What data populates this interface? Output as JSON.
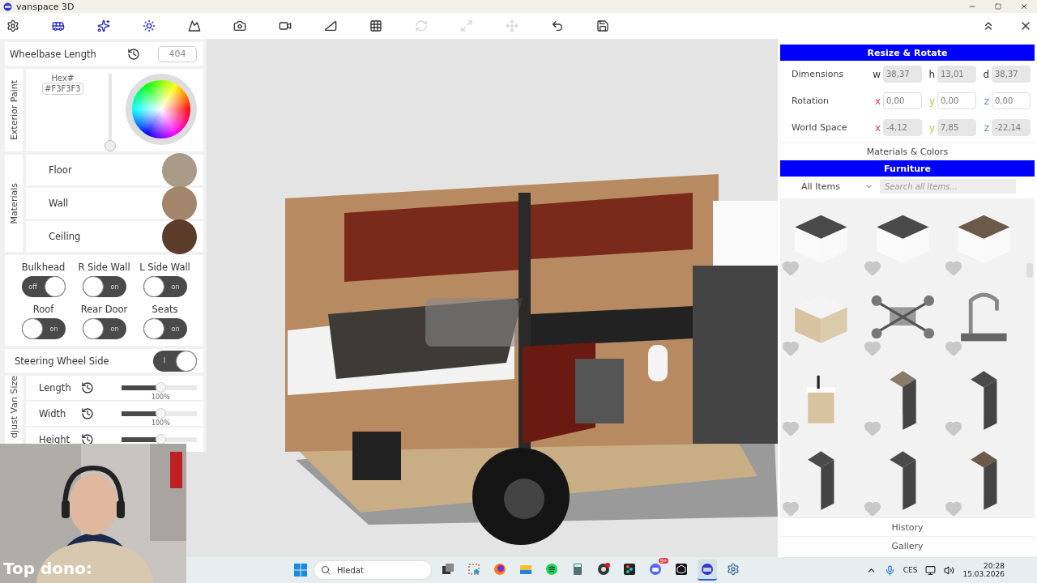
{
  "app": {
    "title": "vanspace 3D"
  },
  "toolbar": {
    "tools": [
      {
        "kind": "settings",
        "active": false,
        "disabled": false
      },
      {
        "kind": "van",
        "active": true,
        "disabled": false
      },
      {
        "kind": "sparkles",
        "active": true,
        "disabled": false
      },
      {
        "kind": "sun",
        "active": true,
        "disabled": false
      },
      {
        "kind": "terrain",
        "active": false,
        "disabled": false
      },
      {
        "kind": "camera",
        "active": false,
        "disabled": false
      },
      {
        "kind": "video",
        "active": false,
        "disabled": false
      },
      {
        "kind": "ruler",
        "active": false,
        "disabled": false
      },
      {
        "kind": "grid",
        "active": false,
        "disabled": false
      },
      {
        "kind": "rotate",
        "active": false,
        "disabled": true
      },
      {
        "kind": "resize",
        "active": false,
        "disabled": true
      },
      {
        "kind": "move",
        "active": false,
        "disabled": true
      },
      {
        "kind": "undo",
        "active": false,
        "disabled": false
      },
      {
        "kind": "save",
        "active": false,
        "disabled": false
      }
    ]
  },
  "left_panel": {
    "wheelbase": {
      "label": "Wheelbase Length",
      "value": "404"
    },
    "exterior_paint": {
      "title": "Exterior Paint",
      "hex_label": "Hex#",
      "hex_value": "#F3F3F3",
      "brightness": {
        "level": 0
      }
    },
    "materials": {
      "title": "Materials",
      "items": [
        {
          "label": "Floor",
          "color": "#a99b88"
        },
        {
          "label": "Wall",
          "color": "#a2856b"
        },
        {
          "label": "Ceiling",
          "color": "#5b3b29"
        }
      ]
    },
    "toggles": [
      {
        "label": "Bulkhead",
        "text": "off",
        "on": true
      },
      {
        "label": "R Side Wall",
        "text": "on",
        "on": false
      },
      {
        "label": "L Side Wall",
        "text": "on",
        "on": false
      },
      {
        "label": "Roof",
        "text": "on",
        "on": false
      },
      {
        "label": "Rear Door",
        "text": "on",
        "on": false
      },
      {
        "label": "Seats",
        "text": "on",
        "on": false
      }
    ],
    "steering": {
      "label": "Steering Wheel Side",
      "text": "I",
      "on": true
    },
    "van_size": {
      "title": "djust Van Size",
      "sliders": [
        {
          "label": "Length",
          "level": 0.52,
          "reading": "100%"
        },
        {
          "label": "Width",
          "level": 0.52,
          "reading": "100%"
        },
        {
          "label": "Height",
          "level": 0.52
        }
      ]
    }
  },
  "right_panel": {
    "resize": {
      "title": "Resize & Rotate",
      "rows": [
        {
          "label": "Dimensions",
          "fields": [
            {
              "axis": "w",
              "color": "#333333",
              "value": "38,37",
              "readonly": true
            },
            {
              "axis": "h",
              "color": "#333333",
              "value": "13,01",
              "readonly": true
            },
            {
              "axis": "d",
              "color": "#333333",
              "value": "38,37",
              "readonly": true
            }
          ]
        },
        {
          "label": "Rotation",
          "fields": [
            {
              "axis": "x",
              "color": "#d0405a",
              "value": "0,00",
              "readonly": false
            },
            {
              "axis": "y",
              "color": "#a8d040",
              "value": "0,00",
              "readonly": false
            },
            {
              "axis": "z",
              "color": "#5a8ad8",
              "value": "0,00",
              "readonly": false
            }
          ]
        },
        {
          "label": "World Space",
          "fields": [
            {
              "axis": "x",
              "color": "#d0405a",
              "value": "-4,12",
              "readonly": true
            },
            {
              "axis": "y",
              "color": "#a8d040",
              "value": "7,85",
              "readonly": true
            },
            {
              "axis": "z",
              "color": "#5a8ad8",
              "value": "-22,14",
              "readonly": true
            }
          ]
        }
      ]
    },
    "materials_link": "Materials & Colors",
    "furniture": {
      "title": "Furniture",
      "filter": "All Items",
      "search_placeholder": "Search all items..."
    },
    "sections": [
      "History",
      "Gallery"
    ]
  },
  "webcam": {
    "caption": "Top dono:"
  },
  "taskbar": {
    "search_placeholder": "Hledat",
    "apps": [
      {
        "kind": "taskview",
        "active": false
      },
      {
        "kind": "snipping",
        "active": false
      },
      {
        "kind": "firefox",
        "active": false
      },
      {
        "kind": "files",
        "active": false
      },
      {
        "kind": "spotify",
        "active": false
      },
      {
        "kind": "calculator",
        "active": false
      },
      {
        "kind": "obs",
        "active": false
      },
      {
        "kind": "figma",
        "active": false
      },
      {
        "kind": "discord",
        "active": false,
        "badge": "9+"
      },
      {
        "kind": "unity",
        "active": false
      },
      {
        "kind": "vanspace",
        "active": true
      },
      {
        "kind": "settings",
        "active": false
      }
    ],
    "language": "CES",
    "time": "20:28",
    "date": "15.03.2026"
  }
}
